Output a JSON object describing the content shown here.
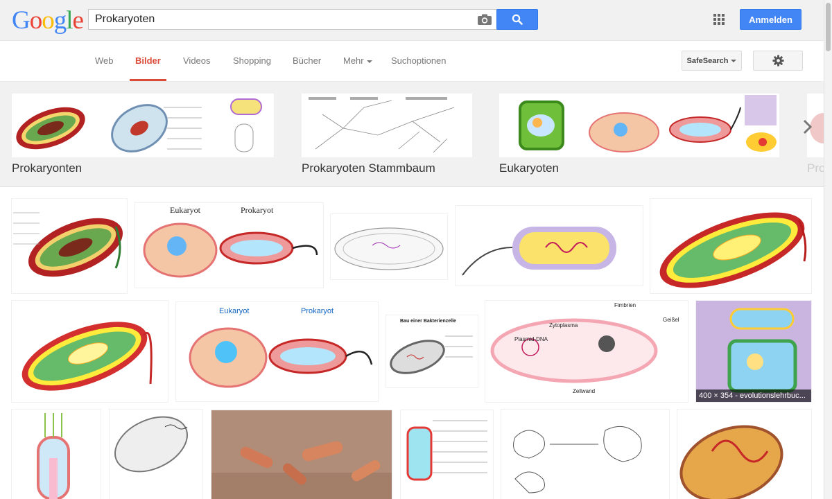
{
  "header": {
    "logo_letters": [
      "G",
      "o",
      "o",
      "g",
      "l",
      "e"
    ],
    "search_value": "Prokaryoten",
    "signin_label": "Anmelden"
  },
  "nav": {
    "tabs": [
      "Web",
      "Bilder",
      "Videos",
      "Shopping",
      "Bücher",
      "Mehr",
      "Suchoptionen"
    ],
    "active_tab": "Bilder",
    "safesearch_label": "SafeSearch"
  },
  "related_searches": [
    {
      "label": "Prokaryonten"
    },
    {
      "label": "Prokaryoten Stammbaum"
    },
    {
      "label": "Eukaryoten"
    },
    {
      "label": "Pro"
    }
  ],
  "results": {
    "rows": [
      [
        {
          "type": "bacterium",
          "colors": [
            "#b22222",
            "#4caf50",
            "#c0392b"
          ]
        },
        {
          "type": "comparison",
          "labels": [
            "Eukaryot",
            "Prokaryot"
          ]
        },
        {
          "type": "sketch"
        },
        {
          "type": "sketch-violet"
        },
        {
          "type": "bacterium",
          "colors": [
            "#c62828",
            "#ffeb3b",
            "#66bb6a"
          ]
        }
      ],
      [
        {
          "type": "bacterium",
          "colors": [
            "#d32f2f",
            "#ffeb3b",
            "#66bb6a"
          ]
        },
        {
          "type": "comparison-blue",
          "labels": [
            "Eukaryot",
            "Prokaryot"
          ]
        },
        {
          "type": "sketch",
          "title": "Bau einer Bakterienzelle"
        },
        {
          "type": "pink-cell",
          "labels": [
            "Fimbrien",
            "Geißel",
            "Zytoplasma",
            "Plasmid-DNA",
            "Zellwand"
          ]
        },
        {
          "type": "purple-chart",
          "caption": "400 × 354 - evolutionslehrbuc..."
        }
      ],
      [
        {
          "type": "sketch"
        },
        {
          "type": "sketch"
        },
        {
          "type": "photo"
        },
        {
          "type": "sketch"
        },
        {
          "type": "sketch"
        },
        {
          "type": "orange-cell"
        }
      ]
    ]
  },
  "colors": {
    "accent_blue": "#4285f4",
    "active_red": "#dd4b39",
    "header_bg": "#f1f1f1"
  }
}
